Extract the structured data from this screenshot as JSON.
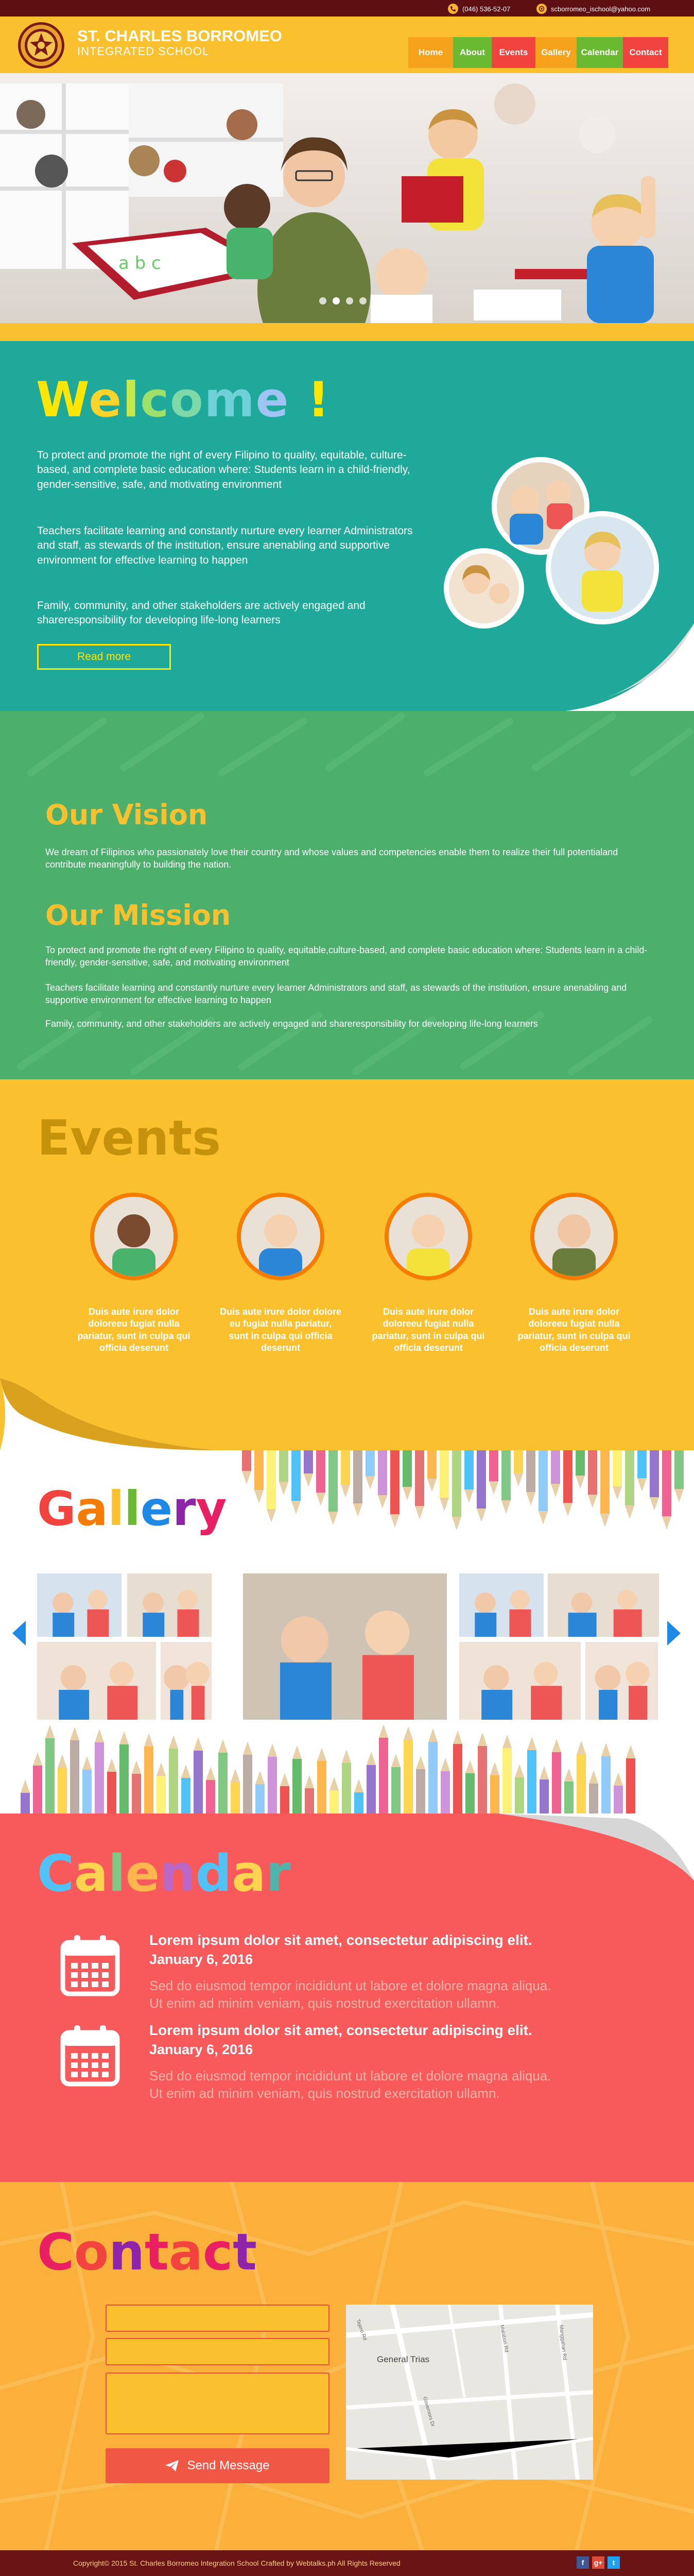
{
  "topbar": {
    "phone": "(046) 536-52-07",
    "email": "scborromeo_ischool@yahoo.com"
  },
  "header": {
    "school_line1": "ST. CHARLES BORROMEO",
    "school_line2": "INTEGRATED SCHOOL",
    "nav": [
      {
        "label": "Home",
        "color": "#f7a21b",
        "width": 87
      },
      {
        "label": "About",
        "color": "#69b931",
        "width": 75
      },
      {
        "label": "Events",
        "color": "#f2433e",
        "width": 85
      },
      {
        "label": "Gallery",
        "color": "#f7a21b",
        "width": 80
      },
      {
        "label": "Calendar",
        "color": "#69b931",
        "width": 90
      },
      {
        "label": "Contact",
        "color": "#f2433e",
        "width": 88
      }
    ]
  },
  "hero": {
    "slide_count": 6,
    "active_slide": 1,
    "board_text": "a b c"
  },
  "welcome": {
    "title": "Welcome !",
    "p1": "To protect and promote the right of every Filipino to quality, equitable, culture-based, and complete basic education where: Students learn in a child-friendly, gender-sensitive, safe, and motivating environment",
    "p2": "Teachers facilitate learning and constantly nurture every learner Administrators and staff, as stewards of the institution, ensure anenabling and supportive environment for effective learning to happen",
    "p3": "Family, community, and other stakeholders are actively engaged and shareresponsibility for developing life-long learners",
    "read_more": "Read more"
  },
  "vision": {
    "vision_title": "Our Vision",
    "vision_text": "We dream of Filipinos who passionately love their country and whose values and competencies enable them to realize their full potentialand contribute meaningfully to building the nation.",
    "mission_title": "Our Mission",
    "mission_p1": "To protect and promote the right of every Filipino to quality, equitable,culture-based, and complete basic education where: Students learn in a child-friendly, gender-sensitive, safe, and motivating environment",
    "mission_p2": "Teachers facilitate learning and constantly nurture every learner Administrators and staff, as stewards of the institution, ensure anenabling and supportive environment for effective learning to happen",
    "mission_p3": "Family, community, and other stakeholders are actively engaged and shareresponsibility for developing life-long learners"
  },
  "events": {
    "title": "Events",
    "items": [
      {
        "text": "Duis aute irure dolor doloreeu fugiat nulla pariatur, sunt in culpa qui officia deserunt"
      },
      {
        "text": "Duis aute irure dolor dolore eu fugiat nulla pariatur, sunt in culpa qui officia deserunt"
      },
      {
        "text": "Duis aute irure dolor doloreeu fugiat nulla pariatur, sunt in culpa qui officia deserunt"
      },
      {
        "text": "Duis aute irure dolor doloreeu fugiat nulla pariatur, sunt in culpa qui officia deserunt"
      }
    ]
  },
  "gallery": {
    "title": "Gallery"
  },
  "calendar": {
    "title": "Calendar",
    "items": [
      {
        "title": "Lorem ipsum dolor sit amet, consectetur adipiscing elit.",
        "date": "January 6, 2016",
        "desc1": "Sed do eiusmod tempor incididunt ut labore et dolore magna aliqua.",
        "desc2": "Ut enim ad minim veniam, quis nostrud exercitation ullamn."
      },
      {
        "title": "Lorem ipsum dolor sit amet, consectetur adipiscing elit.",
        "date": "January 6, 2016",
        "desc1": "Sed do eiusmod tempor incididunt ut labore et dolore magna aliqua.",
        "desc2": "Ut enim ad minim veniam, quis nostrud exercitation ullamn."
      }
    ]
  },
  "contact": {
    "title": "Contact",
    "send_label": "Send Message",
    "map_labels": {
      "town": "General Trias",
      "road1": "Tejero Rd",
      "road2": "Malabon Rd",
      "road3": "Manggahan Rd",
      "road4": "Governors Dr"
    }
  },
  "footer": {
    "copyright": "Copyright© 2015 St. Charles Borromeo Integration School Crafted by Webtalks.ph All Rights Reserved",
    "social": [
      "facebook-icon",
      "google-plus-icon",
      "twitter-icon"
    ]
  },
  "colors": {
    "yellow": "#fbc02d",
    "teal": "#1fa99a",
    "green": "#4caf6c",
    "red": "#f85a5c",
    "orange": "#fbb03b",
    "maroon": "#5d0f12"
  }
}
